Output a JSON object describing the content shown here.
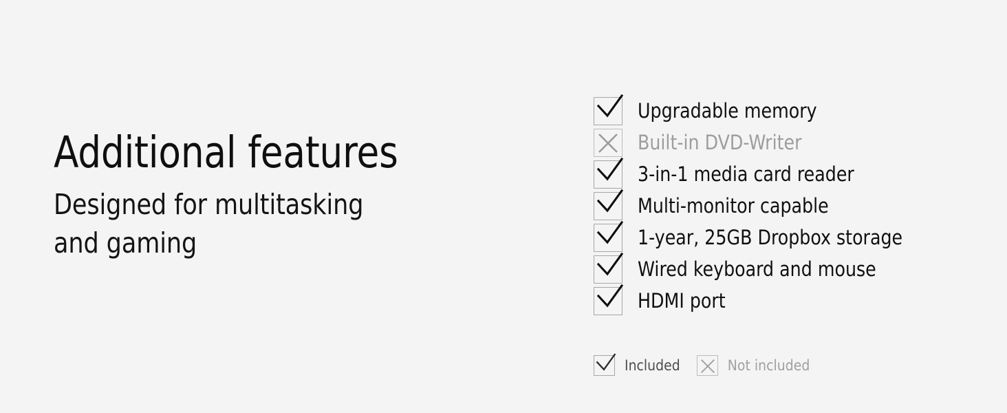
{
  "page": {
    "background_color": "#f4f4f4",
    "headline": "Additional features",
    "subhead_line_1": "Designed for multitasking",
    "subhead_line_2": "and gaming"
  },
  "colors": {
    "text_primary": "#0f0f0f",
    "text_muted": "#9d9d9d",
    "box_border": "#a6a6a6",
    "box_border_muted": "#bdbdbd",
    "legend_text": "#4e4e4e",
    "legend_text_muted": "#a0a0a0"
  },
  "features": [
    {
      "label": "Upgradable memory",
      "status": "included",
      "icon": "check-icon"
    },
    {
      "label": "Built-in DVD-Writer",
      "status": "not-included",
      "icon": "cross-icon"
    },
    {
      "label": "3-in-1 media card reader",
      "status": "included",
      "icon": "check-icon"
    },
    {
      "label": "Multi-monitor capable",
      "status": "included",
      "icon": "check-icon"
    },
    {
      "label": "1-year, 25GB Dropbox storage",
      "status": "included",
      "icon": "check-icon"
    },
    {
      "label": "Wired keyboard and mouse",
      "status": "included",
      "icon": "check-icon"
    },
    {
      "label": "HDMI port",
      "status": "included",
      "icon": "check-icon"
    }
  ],
  "legend": [
    {
      "label": "Included",
      "status": "included",
      "icon": "check-icon"
    },
    {
      "label": "Not included",
      "status": "not-included",
      "icon": "cross-icon"
    }
  ]
}
